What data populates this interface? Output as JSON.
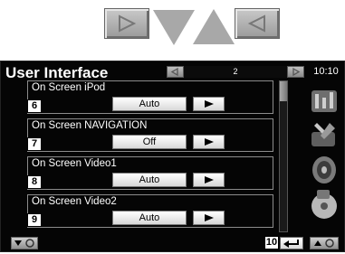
{
  "header": {
    "title": "User Interface",
    "page_number": "2",
    "clock": "10:10"
  },
  "rows": [
    {
      "label": "On Screen iPod",
      "value": "Auto",
      "callout": "6"
    },
    {
      "label": "On Screen NAVIGATION",
      "value": "Off",
      "callout": "7"
    },
    {
      "label": "On Screen Video1",
      "value": "Auto",
      "callout": "8"
    },
    {
      "label": "On Screen Video2",
      "value": "Auto",
      "callout": "9"
    }
  ],
  "footer": {
    "return_callout": "10"
  },
  "icons": {
    "top_arrows": [
      "play-right-icon",
      "triangle-down-icon",
      "triangle-up-icon",
      "play-left-icon"
    ],
    "sidebar": [
      "audio-settings-icon",
      "tools-icon",
      "speaker-icon",
      "disc-icon"
    ],
    "footer": [
      "scroll-down-icon",
      "return-icon",
      "scroll-up-icon"
    ]
  },
  "colors": {
    "screen_background": "#050505",
    "arrow_gray": "#a8a8a8"
  }
}
